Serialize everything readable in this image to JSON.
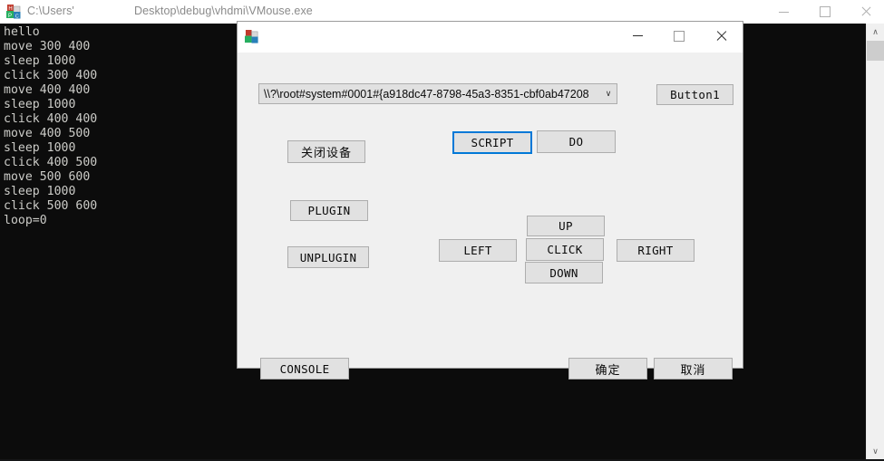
{
  "console_window": {
    "icon": "app-blocks-icon",
    "title_user": "C:\\Users'",
    "title_path": "Desktop\\debug\\vhdmi\\VMouse.exe",
    "controls": {
      "minimize": "minimize-icon",
      "maximize": "maximize-icon",
      "close": "close-icon"
    },
    "output_text": "hello\nmove 300 400\nsleep 1000\nclick 300 400\nmove 400 400\nsleep 1000\nclick 400 400\nmove 400 500\nsleep 1000\nclick 400 500\nmove 500 600\nsleep 1000\nclick 500 600\nloop=0",
    "scrollbar": {
      "up_arrow": "∧",
      "down_arrow": "∨"
    }
  },
  "dialog": {
    "icon": "app-blocks-icon",
    "title": "",
    "controls": {
      "minimize": "minimize-icon",
      "maximize": "maximize-icon",
      "close": "close-icon"
    },
    "device_combo": {
      "value": "\\\\?\\root#system#0001#{a918dc47-8798-45a3-8351-cbf0ab47208",
      "arrow": "∨"
    },
    "buttons": {
      "button1": "Button1",
      "close_device": "关闭设备",
      "script": "SCRIPT",
      "do": "DO",
      "plugin": "PLUGIN",
      "unplugin": "UNPLUGIN",
      "up": "UP",
      "left": "LEFT",
      "click": "CLICK",
      "right": "RIGHT",
      "down": "DOWN",
      "console": "CONSOLE",
      "ok": "确定",
      "cancel": "取消"
    },
    "focused_button": "SCRIPT"
  },
  "colors": {
    "console_bg": "#0c0c0c",
    "console_text": "#ccccc8",
    "dialog_bg": "#f0f0f0",
    "button_face": "#e1e1e1",
    "button_border": "#adadad",
    "focus_accent": "#0078d7"
  }
}
